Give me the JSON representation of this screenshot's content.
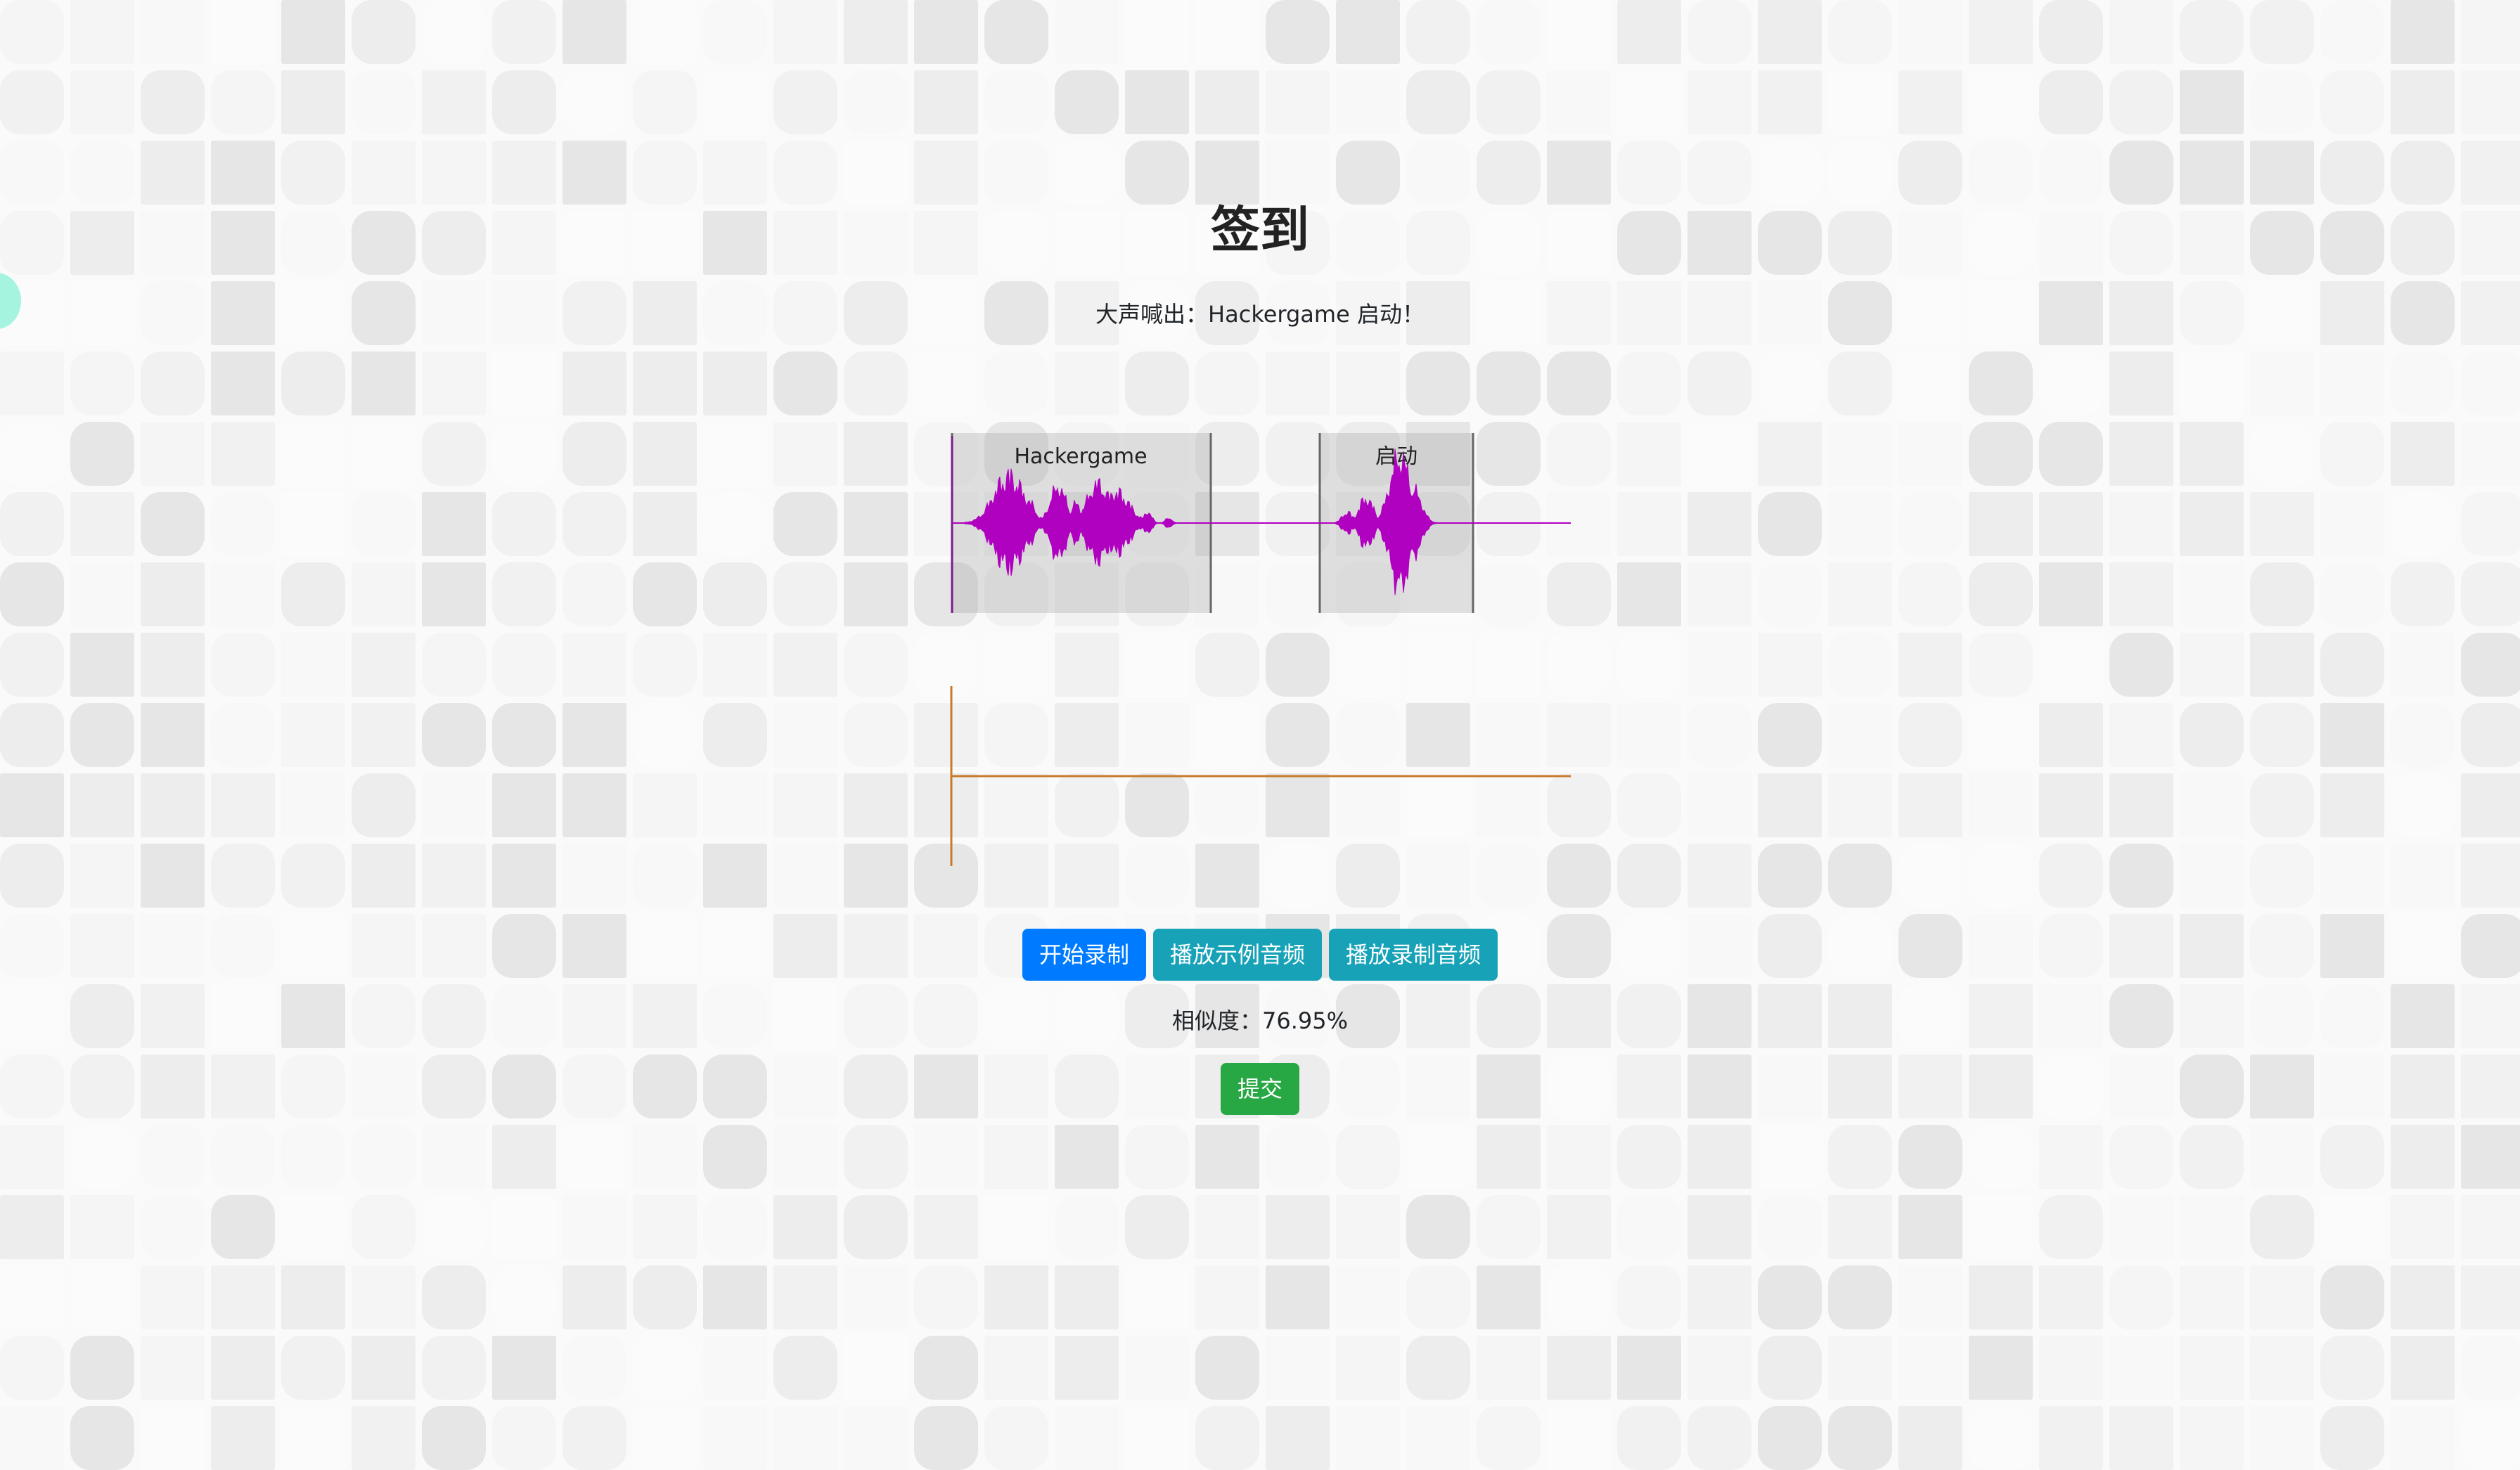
{
  "title": "签到",
  "instruction": "大声喊出：Hackergame 启动！",
  "waveforms": {
    "reference_segments": [
      "Hackergame",
      "启动"
    ]
  },
  "buttons": {
    "record": "开始录制",
    "play_example": "播放示例音频",
    "play_recording": "播放录制音频",
    "submit": "提交"
  },
  "similarity": "相似度：76.95%",
  "colors": {
    "reference_wave": "#b000c0",
    "recording_wave": "#c87a2a",
    "primary_button": "#007bff",
    "info_button": "#17a2b8",
    "success_button": "#28a745",
    "side_accent": "#a5f4e0"
  }
}
